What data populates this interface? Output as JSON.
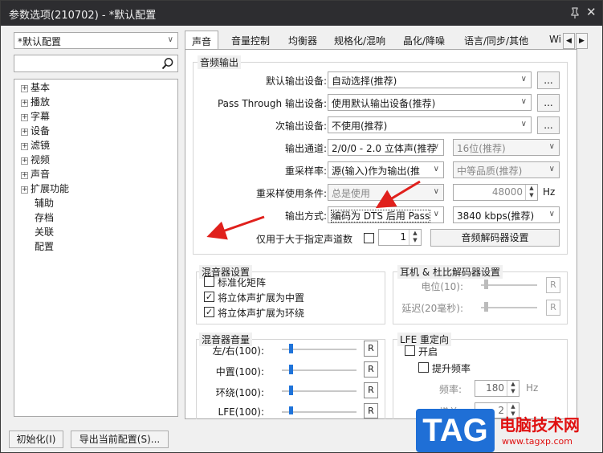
{
  "window": {
    "title": "参数选项(210702) - *默认配置"
  },
  "profile": {
    "selected": "*默认配置"
  },
  "search": {
    "placeholder": ""
  },
  "tree": [
    {
      "label": "基本",
      "expandable": true
    },
    {
      "label": "播放",
      "expandable": true
    },
    {
      "label": "字幕",
      "expandable": true
    },
    {
      "label": "设备",
      "expandable": true
    },
    {
      "label": "滤镜",
      "expandable": true
    },
    {
      "label": "视频",
      "expandable": true
    },
    {
      "label": "声音",
      "expandable": true
    },
    {
      "label": "扩展功能",
      "expandable": true
    },
    {
      "label": "辅助",
      "expandable": false
    },
    {
      "label": "存档",
      "expandable": false
    },
    {
      "label": "关联",
      "expandable": false
    },
    {
      "label": "配置",
      "expandable": false
    }
  ],
  "tabs": [
    "声音",
    "音量控制",
    "均衡器",
    "规格化/混响",
    "晶化/降噪",
    "语言/同步/其他",
    "Wi"
  ],
  "audio_output": {
    "title": "音频输出",
    "default_device": {
      "label": "默认输出设备:",
      "value": "自动选择(推荐)",
      "more": "..."
    },
    "passthrough_device": {
      "label": "Pass Through 输出设备:",
      "value": "使用默认输出设备(推荐)",
      "more": "..."
    },
    "secondary_device": {
      "label": "次输出设备:",
      "value": "不使用(推荐)",
      "more": "..."
    },
    "channels": {
      "label": "输出通道:",
      "value": "2/0/0 - 2.0 立体声(推荐",
      "bits": "16位(推荐)"
    },
    "resample": {
      "label": "重采样率:",
      "value": "源(输入)作为输出(推",
      "quality": "中等品质(推荐)"
    },
    "resample_condition": {
      "label": "重采样使用条件:",
      "value": "总是使用",
      "rate": "48000",
      "unit": "Hz"
    },
    "output_mode": {
      "label": "输出方式:",
      "value": "编码为 DTS 后用 Pass",
      "bitrate": "3840 kbps(推荐)"
    },
    "channel_threshold": {
      "label": "仅用于大于指定声道数",
      "value": "1"
    },
    "decoder_settings": "音频解码器设置"
  },
  "mixer_settings": {
    "title": "混音器设置",
    "options": [
      {
        "label": "标准化矩阵",
        "checked": false
      },
      {
        "label": "将立体声扩展为中置",
        "checked": true
      },
      {
        "label": "将立体声扩展为环绕",
        "checked": true
      }
    ]
  },
  "headphone": {
    "title": "耳机 & 杜比解码器设置",
    "level": {
      "label": "电位(10):",
      "reset": "R",
      "position": 0.05
    },
    "delay": {
      "label": "延迟(20毫秒):",
      "reset": "R",
      "position": 0.05
    }
  },
  "mixer_volume": {
    "title": "混音器音量",
    "rows": [
      {
        "label": "左/右(100):",
        "reset": "R",
        "position": 0.1
      },
      {
        "label": "中置(100):",
        "reset": "R",
        "position": 0.1
      },
      {
        "label": "环绕(100):",
        "reset": "R",
        "position": 0.1
      },
      {
        "label": "LFE(100):",
        "reset": "R",
        "position": 0.1
      }
    ]
  },
  "lfe": {
    "title": "LFE 重定向",
    "enable": {
      "label": "开启",
      "checked": false
    },
    "boost": {
      "label": "提升频率",
      "checked": false
    },
    "freq": {
      "label": "频率:",
      "value": "180",
      "unit": "Hz"
    },
    "gain": {
      "label": "增益:",
      "value": "2"
    }
  },
  "footer": {
    "reset": "初始化(I)",
    "export": "导出当前配置(S)..."
  },
  "watermark": {
    "logo": "TAG",
    "name": "电脑技术网",
    "url": "www.tagxp.com"
  },
  "colors": {
    "accent": "#1f73d9",
    "arrow": "#e0201c",
    "titlebar": "#2d2d30"
  }
}
